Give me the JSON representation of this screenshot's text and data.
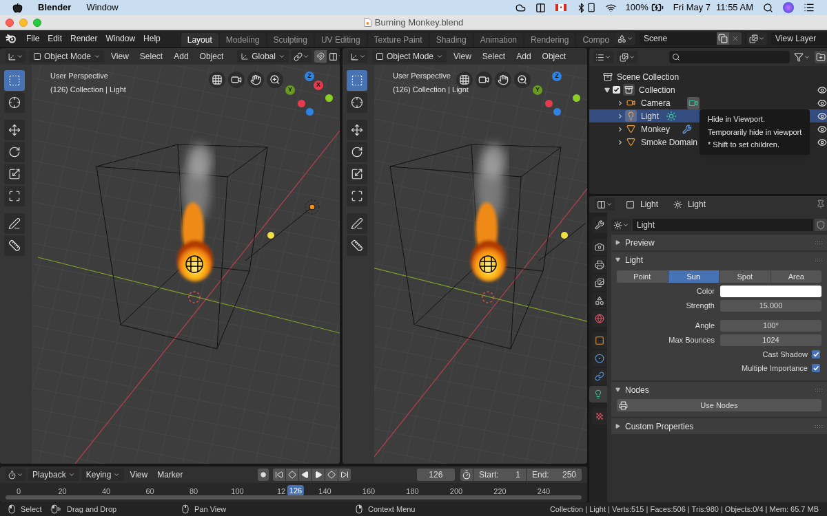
{
  "menubar": {
    "app": "Blender",
    "menus": [
      "Window"
    ],
    "battery": "100%",
    "date": "Fri May 7",
    "time": "11:55 AM"
  },
  "window": {
    "title": "Burning Monkey.blend"
  },
  "topbar": {
    "menus": [
      "File",
      "Edit",
      "Render",
      "Window",
      "Help"
    ],
    "workspaces": [
      {
        "label": "Layout",
        "selected": true
      },
      {
        "label": "Modeling",
        "selected": false
      },
      {
        "label": "Sculpting",
        "selected": false
      },
      {
        "label": "UV Editing",
        "selected": false
      },
      {
        "label": "Texture Paint",
        "selected": false
      },
      {
        "label": "Shading",
        "selected": false
      },
      {
        "label": "Animation",
        "selected": false
      },
      {
        "label": "Rendering",
        "selected": false
      },
      {
        "label": "Compo",
        "selected": false
      }
    ],
    "scene": "Scene",
    "view_layer": "View Layer"
  },
  "viewports": [
    {
      "mode": "Object Mode",
      "menus": [
        "View",
        "Select",
        "Add",
        "Object"
      ],
      "orientation": "Global",
      "view_name": "User Perspective",
      "info": "(126) Collection | Light",
      "tools": [
        {
          "kind": "select",
          "selected": true
        },
        {
          "kind": "cursor",
          "selected": false
        },
        {
          "kind": "move",
          "selected": false
        },
        {
          "kind": "rotate",
          "selected": false
        },
        {
          "kind": "scale",
          "selected": false
        },
        {
          "kind": "transform",
          "selected": false
        },
        {
          "kind": "annotate",
          "selected": false
        },
        {
          "kind": "measure",
          "selected": false
        }
      ],
      "gizmo": [
        {
          "label": "Z",
          "color": "#2f83e3"
        },
        {
          "label": "Y",
          "color": "#6a9a1f"
        },
        {
          "label": "X",
          "color": "#e53b4e"
        }
      ]
    },
    {
      "mode": "Object Mode",
      "menus": [
        "View",
        "Select",
        "Add",
        "Object"
      ],
      "view_name": "User Perspective",
      "info": "(126) Collection | Light",
      "tools": [
        {
          "kind": "select",
          "selected": true
        },
        {
          "kind": "cursor",
          "selected": false
        },
        {
          "kind": "move",
          "selected": false
        },
        {
          "kind": "rotate",
          "selected": false
        },
        {
          "kind": "scale",
          "selected": false
        },
        {
          "kind": "transform",
          "selected": false
        },
        {
          "kind": "annotate",
          "selected": false
        },
        {
          "kind": "measure",
          "selected": false
        }
      ],
      "gizmo": [
        {
          "label": "Z",
          "color": "#2f83e3"
        },
        {
          "label": "Y",
          "color": "#6a9a1f"
        }
      ]
    }
  ],
  "outliner": {
    "root": "Scene Collection",
    "tree": [
      {
        "label": "Collection",
        "kind": "collection",
        "checked": true,
        "expanded": true,
        "selected": false,
        "children": [
          {
            "label": "Camera",
            "kind": "camera",
            "expanded": false,
            "selected": false,
            "has_modifier": false
          },
          {
            "label": "Light",
            "kind": "light",
            "expanded": false,
            "selected": true,
            "has_modifier": false
          },
          {
            "label": "Monkey",
            "kind": "mesh",
            "expanded": false,
            "selected": false,
            "has_modifier": true
          },
          {
            "label": "Smoke Domain",
            "kind": "mesh",
            "expanded": false,
            "selected": false,
            "has_modifier": false
          }
        ]
      }
    ],
    "tooltip": [
      "Hide in Viewport.",
      "Temporarily hide in viewport",
      "* Shift to set children."
    ]
  },
  "properties": {
    "breadcrumb": [
      "Light",
      "Light"
    ],
    "datablock": "Light",
    "tabs": [
      {
        "kind": "tool",
        "selected": false
      },
      {
        "kind": "render",
        "selected": false
      },
      {
        "kind": "output",
        "selected": false
      },
      {
        "kind": "view_layer",
        "selected": false
      },
      {
        "kind": "scene",
        "selected": false
      },
      {
        "kind": "world",
        "selected": false
      },
      {
        "kind": "object",
        "selected": false
      },
      {
        "kind": "physics",
        "selected": false
      },
      {
        "kind": "constraints",
        "selected": false
      },
      {
        "kind": "data",
        "selected": true
      },
      {
        "kind": "texture",
        "selected": false
      }
    ],
    "panels": [
      {
        "title": "Preview",
        "expanded": false
      },
      {
        "title": "Light",
        "expanded": true,
        "kind": "light",
        "light_types": [
          {
            "label": "Point",
            "selected": false
          },
          {
            "label": "Sun",
            "selected": true
          },
          {
            "label": "Spot",
            "selected": false
          },
          {
            "label": "Area",
            "selected": false
          }
        ],
        "fields": [
          {
            "kind": "color",
            "label": "Color"
          },
          {
            "kind": "number",
            "label": "Strength",
            "value": "15.000"
          },
          {
            "kind": "number",
            "label": "Angle",
            "value": "100°"
          },
          {
            "kind": "number",
            "label": "Max Bounces",
            "value": "1024"
          },
          {
            "kind": "checkbox",
            "label": "Cast Shadow",
            "checked": true
          },
          {
            "kind": "checkbox",
            "label": "Multiple Importance",
            "checked": true
          }
        ]
      },
      {
        "title": "Nodes",
        "expanded": true,
        "kind": "nodes",
        "button": "Use Nodes"
      },
      {
        "title": "Custom Properties",
        "expanded": false
      }
    ]
  },
  "timeline": {
    "menus": [
      "Playback",
      "Keying",
      "View",
      "Marker"
    ],
    "frame": "126",
    "start_label": "Start:",
    "start": "1",
    "end_label": "End:",
    "end": "250",
    "ticks": [
      "0",
      "20",
      "40",
      "60",
      "80",
      "100",
      "12",
      "140",
      "160",
      "180",
      "200",
      "220",
      "240"
    ],
    "current": "126",
    "level": 0.504
  },
  "status_bar": {
    "hints": [
      {
        "kind": "left",
        "label": "Select"
      },
      {
        "kind": "drag",
        "label": "Drag and Drop"
      },
      {
        "kind": "middle",
        "label": "Pan View"
      },
      {
        "kind": "right",
        "label": "Context Menu"
      }
    ],
    "stats": "Collection | Light | Verts:515 | Faces:506 | Tris:980 | Objects:0/4 | Mem: 65.7 MB"
  }
}
